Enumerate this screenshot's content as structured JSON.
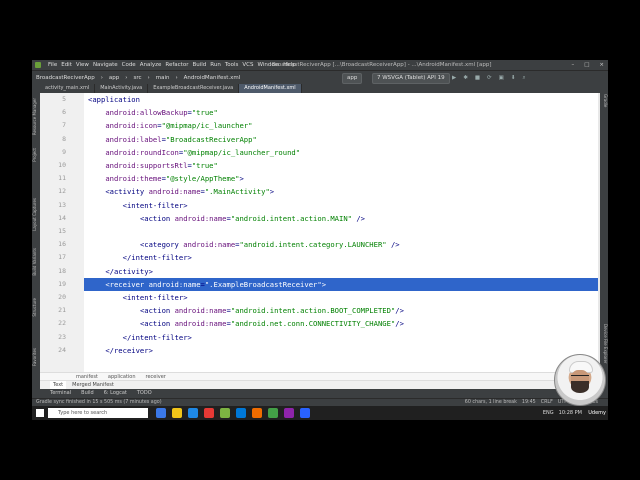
{
  "title_bar": {
    "menu": [
      "File",
      "Edit",
      "View",
      "Navigate",
      "Code",
      "Analyze",
      "Refactor",
      "Build",
      "Run",
      "Tools",
      "VCS",
      "Window",
      "Help"
    ],
    "window_title": "BroadcastReciverApp [...\\BroadcastReceiverApp] - ...\\AndroidManifest.xml [app]"
  },
  "navbar": {
    "crumbs": [
      "BroadcastReciverApp",
      "app",
      "src",
      "main",
      "AndroidManifest.xml"
    ],
    "run_config": "app",
    "device": "7 WSVGA (Tablet) API 19"
  },
  "tabs": [
    {
      "label": "activity_main.xml",
      "active": false
    },
    {
      "label": "MainActivity.java",
      "active": false
    },
    {
      "label": "ExampleBroadcastReceiver.java",
      "active": false
    },
    {
      "label": "AndroidManifest.xml",
      "active": true
    }
  ],
  "left_tools": [
    "Resource Manager",
    "Project",
    "Layout Captures",
    "Build Variants",
    "Structure",
    "Favorites"
  ],
  "right_tools": [
    "Gradle",
    "Device File Explorer"
  ],
  "editor": {
    "highlighted_line": 19,
    "lines": [
      {
        "n": "5",
        "text": "<application"
      },
      {
        "n": "6",
        "text": "    android:allowBackup=\"true\""
      },
      {
        "n": "7",
        "text": "    android:icon=\"@mipmap/ic_launcher\""
      },
      {
        "n": "8",
        "text": "    android:label=\"BroadcastReciverApp\""
      },
      {
        "n": "9",
        "text": "    android:roundIcon=\"@mipmap/ic_launcher_round\""
      },
      {
        "n": "10",
        "text": "    android:supportsRtl=\"true\""
      },
      {
        "n": "11",
        "text": "    android:theme=\"@style/AppTheme\">"
      },
      {
        "n": "12",
        "text": "    <activity android:name=\".MainActivity\">"
      },
      {
        "n": "13",
        "text": "        <intent-filter>"
      },
      {
        "n": "14",
        "text": "            <action android:name=\"android.intent.action.MAIN\" />"
      },
      {
        "n": "15",
        "text": ""
      },
      {
        "n": "16",
        "text": "            <category android:name=\"android.intent.category.LAUNCHER\" />"
      },
      {
        "n": "17",
        "text": "        </intent-filter>"
      },
      {
        "n": "18",
        "text": "    </activity>"
      },
      {
        "n": "19",
        "text": "    <receiver android:name=\".ExampleBroadcastReceiver\">"
      },
      {
        "n": "20",
        "text": "        <intent-filter>"
      },
      {
        "n": "21",
        "text": "            <action android:name=\"android.intent.action.BOOT_COMPLETED\"/>"
      },
      {
        "n": "22",
        "text": "            <action android:name=\"android.net.conn.CONNECTIVITY_CHANGE\"/>"
      },
      {
        "n": "23",
        "text": "        </intent-filter>"
      },
      {
        "n": "24",
        "text": "    </receiver>"
      }
    ]
  },
  "editor_breadcrumb": [
    "manifest",
    "application",
    "receiver"
  ],
  "sub_tabs": [
    {
      "label": "Text",
      "active": true
    },
    {
      "label": "Merged Manifest",
      "active": false
    }
  ],
  "bottom_tools": [
    "Terminal",
    "Build",
    "6: Logcat",
    "TODO"
  ],
  "status": {
    "message": "Gradle sync finished in 15 s 505 ms (7 minutes ago)",
    "right": [
      "60 chars, 1 line break",
      "19:45",
      "CRLF",
      "UTF-8",
      "4 spaces"
    ]
  },
  "taskbar": {
    "search_placeholder": "Type here to search",
    "tray": [
      "ENG",
      "10:28 PM"
    ],
    "watermark": "Udemy"
  },
  "colors": {
    "selection": "#2f65ca",
    "ide_dark": "#3c3f41",
    "string_green": "#008000"
  }
}
